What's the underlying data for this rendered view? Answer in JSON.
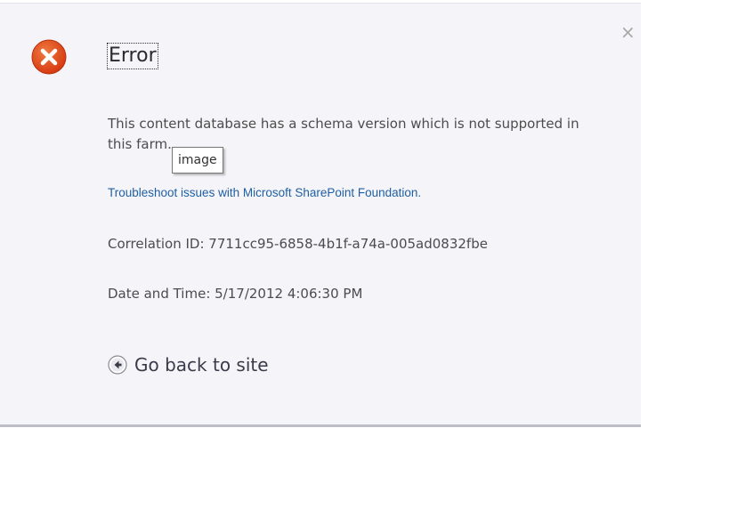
{
  "dialog": {
    "title": "Error",
    "close_glyph": "×",
    "error_icon": "error-x-icon",
    "message": "This content database has a schema version which is not supported in this farm.",
    "tooltip": "image",
    "help_link": "Troubleshoot issues with Microsoft SharePoint Foundation.",
    "correlation_label": "Correlation ID: 7711cc95-6858-4b1f-a74a-005ad0832fbe",
    "datetime_label": "Date and Time: 5/17/2012 4:06:30 PM",
    "go_back_label": "Go back to site",
    "back_icon": "back-arrow-icon"
  },
  "colors": {
    "error_red": "#e04a1c",
    "link_blue": "#1f5fa3",
    "dialog_bg": "#f5f5f9",
    "text_gray": "#4c4c4c"
  }
}
